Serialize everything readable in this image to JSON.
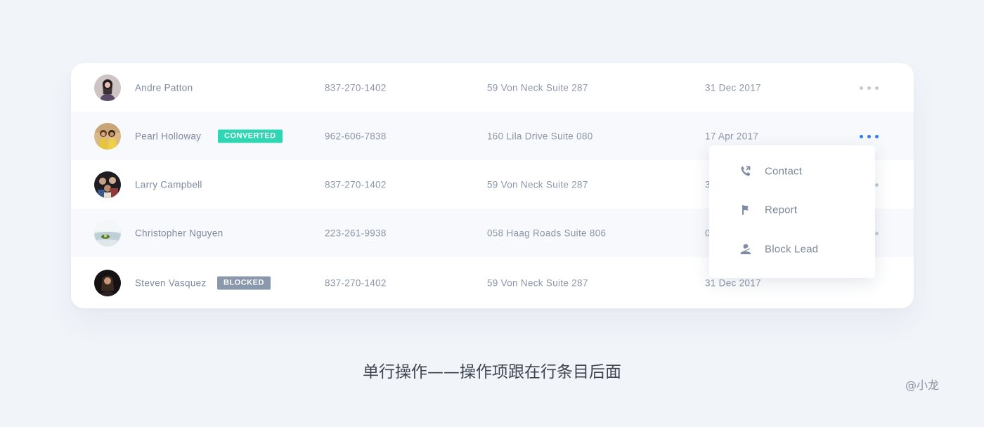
{
  "table": {
    "rows": [
      {
        "name": "Andre Patton",
        "badge": "",
        "phone": "837-270-1402",
        "address": "59 Von Neck Suite 287",
        "date": "31 Dec 2017"
      },
      {
        "name": "Pearl Holloway",
        "badge": "CONVERTED",
        "phone": "962-606-7838",
        "address": "160 Lila Drive Suite 080",
        "date": "17 Apr 2017"
      },
      {
        "name": "Larry Campbell",
        "badge": "",
        "phone": "837-270-1402",
        "address": "59 Von Neck Suite 287",
        "date": "3"
      },
      {
        "name": "Christopher Nguyen",
        "badge": "",
        "phone": "223-261-9938",
        "address": "058 Haag Roads Suite 806",
        "date": "0"
      },
      {
        "name": "Steven Vasquez",
        "badge": "BLOCKED",
        "phone": "837-270-1402",
        "address": "59 Von Neck Suite 287",
        "date": "31 Dec 2017"
      }
    ]
  },
  "row_menu": {
    "items": [
      {
        "label": "Contact",
        "icon": "phone-icon"
      },
      {
        "label": "Report",
        "icon": "flag-icon"
      },
      {
        "label": "Block Lead",
        "icon": "block-user-icon"
      }
    ]
  },
  "caption": "单行操作——操作项跟在行条目后面",
  "signature": "@小龙",
  "colors": {
    "converted_badge": "#2fd6b4",
    "blocked_badge": "#8a98ad",
    "active_dots": "#2f7ff5",
    "inactive_dots": "#c4cbd6"
  }
}
